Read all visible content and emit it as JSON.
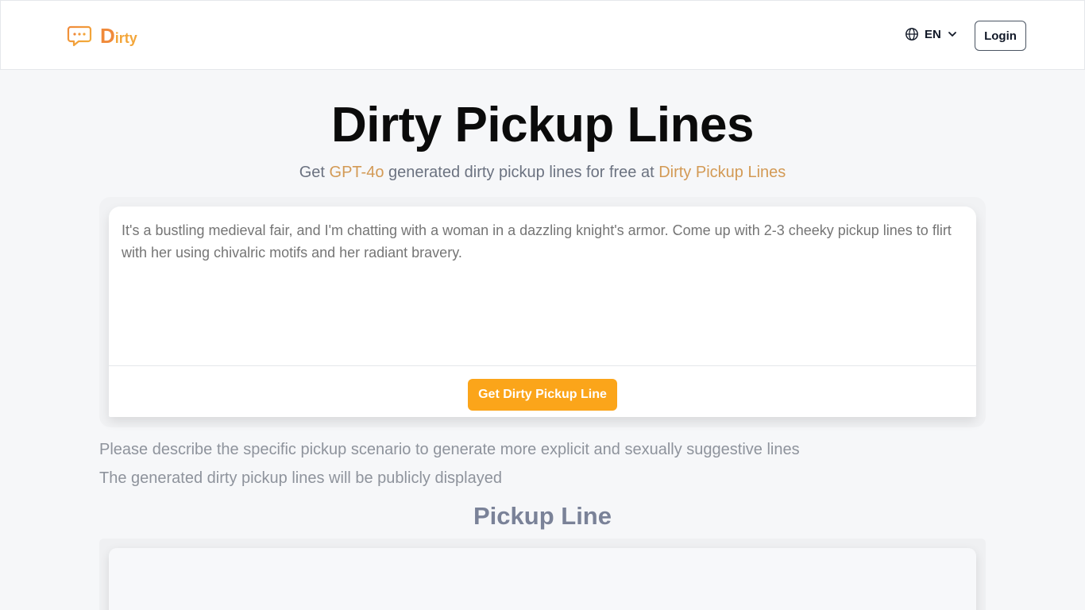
{
  "header": {
    "logo_initial": "D",
    "logo_rest": "irty",
    "logo_icon": "chat-bubble-icon",
    "language": "EN",
    "login_label": "Login"
  },
  "hero": {
    "title": "Dirty Pickup Lines",
    "subtitle_prefix": "Get ",
    "subtitle_model": "GPT-4o",
    "subtitle_middle": " generated dirty pickup lines for free at ",
    "subtitle_site": "Dirty Pickup Lines"
  },
  "generator": {
    "placeholder": "It's a bustling medieval fair, and I'm chatting with a woman in a dazzling knight's armor. Come up with 2-3 cheeky pickup lines to flirt with her using chivalric motifs and her radiant bravery.",
    "button_label": "Get Dirty Pickup Line"
  },
  "notes": {
    "line1": "Please describe the specific pickup scenario to generate more explicit and sexually suggestive lines",
    "line2": "The generated dirty pickup lines will be publicly displayed"
  },
  "results": {
    "heading": "Pickup Line"
  },
  "colors": {
    "accent": "#fba51a",
    "logo_d": "#f08a3a",
    "highlight": "#d39a55"
  }
}
